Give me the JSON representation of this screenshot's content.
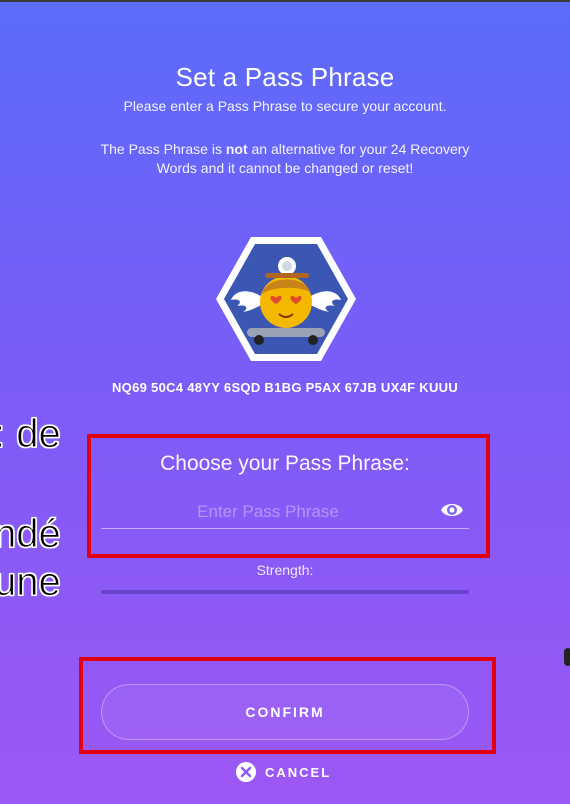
{
  "header": {
    "title": "Set a Pass Phrase",
    "subtitle": "Please enter a Pass Phrase to secure your account.",
    "warning_prefix": "The Pass Phrase is ",
    "warning_bold": "not",
    "warning_suffix": " an alternative for your 24 Recovery Words and it cannot be changed or reset!"
  },
  "account": {
    "avatar_icon": "identicon-emoji-skateboard-icon",
    "address": "NQ69 50C4 48YY 6SQD B1BG P5AX 67JB UX4F KUUU"
  },
  "form": {
    "label": "Choose your Pass Phrase:",
    "placeholder": "Enter Pass Phrase",
    "value": "",
    "visibility_icon": "eye-icon",
    "strength_label": "Strength:",
    "strength_value": 0
  },
  "actions": {
    "confirm_label": "CONFIRM",
    "cancel_label": "CANCEL",
    "cancel_icon": "close-circle-icon"
  },
  "overlay": {
    "line1": ": de",
    "line2": "ndé",
    "line3": "une"
  },
  "colors": {
    "gradient_top": "#5a6cfb",
    "gradient_bottom": "#9d57f4",
    "highlight_box": "#e00012"
  }
}
